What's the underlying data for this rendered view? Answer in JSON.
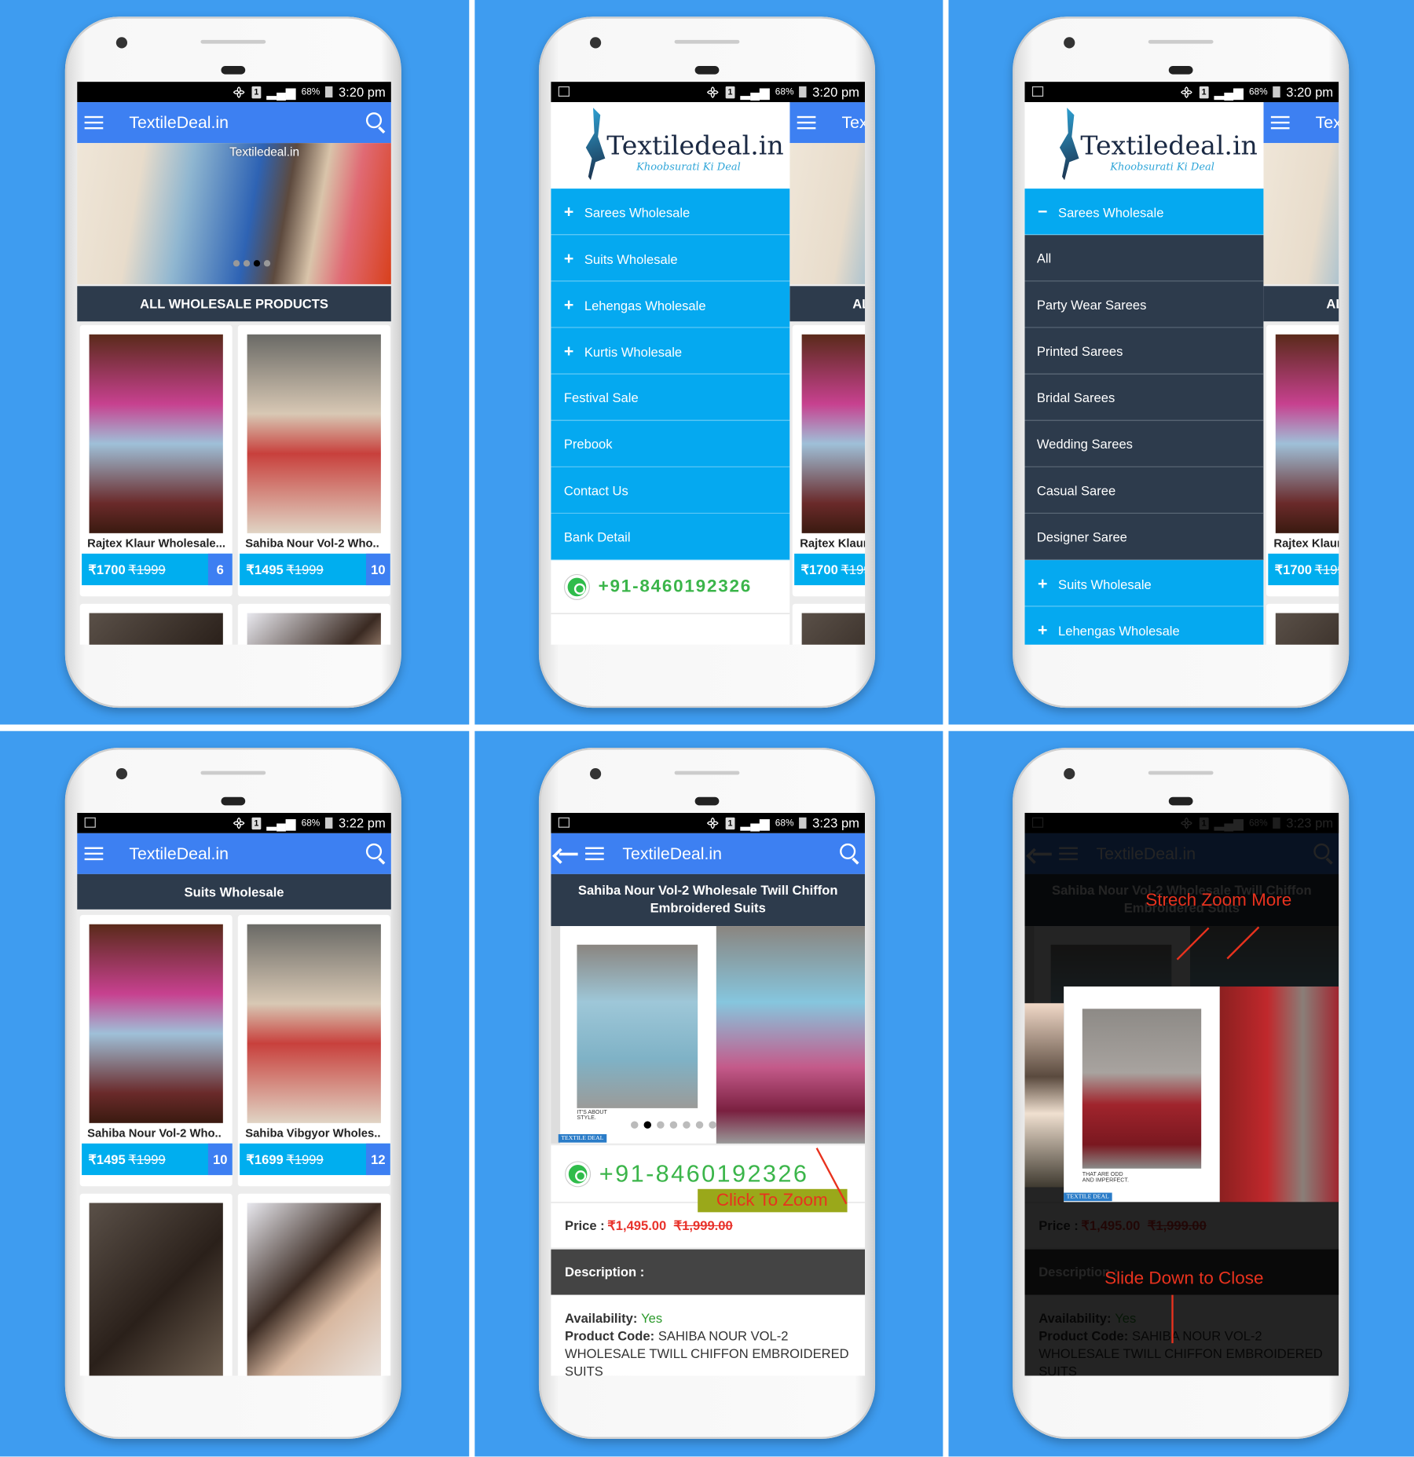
{
  "colors": {
    "background": "#3e9cf0",
    "appbar": "#3d80f2",
    "section_header": "#2d3b4c",
    "price_bar": "#00aeef",
    "count_badge": "#3d7ff2",
    "drawer_item": "#05a9f0",
    "whatsapp_green": "#3bb54a",
    "price_red": "#e8321e",
    "annotation": "#e8321e"
  },
  "status": {
    "battery": "68%",
    "sim": "1",
    "times": [
      "3:20 pm",
      "3:20 pm",
      "3:20 pm",
      "3:22 pm",
      "3:23 pm",
      "3:23 pm"
    ]
  },
  "app_title": "TextileDeal.in",
  "banner": {
    "watermark": "Textiledeal.in",
    "slides": 4,
    "active_slide": 3
  },
  "home": {
    "section_title": "ALL WHOLESALE PRODUCTS",
    "products": [
      {
        "name": "Rajtex Klaur Wholesale...",
        "price": "₹1700",
        "mrp": "₹1999",
        "count": "6"
      },
      {
        "name": "Sahiba Nour Vol-2 Who..",
        "price": "₹1495",
        "mrp": "₹1999",
        "count": "10"
      }
    ]
  },
  "drawer": {
    "logo_text": "Textiledeal.in",
    "logo_tagline": "Khoobsurati Ki Deal",
    "phone": "+91-8460192326",
    "items": [
      {
        "label": "Sarees Wholesale",
        "icon": "plus"
      },
      {
        "label": "Suits Wholesale",
        "icon": "plus"
      },
      {
        "label": "Lehengas Wholesale",
        "icon": "plus"
      },
      {
        "label": "Kurtis Wholesale",
        "icon": "plus"
      },
      {
        "label": "Festival Sale",
        "icon": ""
      },
      {
        "label": "Prebook",
        "icon": ""
      },
      {
        "label": "Contact Us",
        "icon": ""
      },
      {
        "label": "Bank Detail",
        "icon": ""
      }
    ],
    "expanded": {
      "label": "Sarees Wholesale",
      "icon": "minus",
      "subitems": [
        "All",
        "Party Wear Sarees",
        "Printed Sarees",
        "Bridal Sarees",
        "Wedding Sarees",
        "Casual Saree",
        "Designer Saree"
      ],
      "after": [
        {
          "label": "Suits Wholesale",
          "icon": "plus"
        },
        {
          "label": "Lehengas Wholesale",
          "icon": "plus"
        }
      ]
    }
  },
  "suits": {
    "section_title": "Suits Wholesale",
    "products": [
      {
        "name": "Sahiba Nour Vol-2 Who..",
        "price": "₹1495",
        "mrp": "₹1999",
        "count": "10"
      },
      {
        "name": "Sahiba Vibgyor Wholes..",
        "price": "₹1699",
        "mrp": "₹1999",
        "count": "12"
      }
    ]
  },
  "detail": {
    "title": "Sahiba Nour Vol-2 Wholesale Twill Chiffon Embroidered Suits",
    "image_caption": "IT'S ABOUT STYLE.",
    "image_badge": "TEXTILE DEAL",
    "carousel": {
      "count": 7,
      "active": 2
    },
    "phone": "+91-8460192326",
    "price_label": "Price :",
    "price": "₹1,495.00",
    "mrp": "₹1,999.00",
    "description_label": "Description :",
    "availability_label": "Availability:",
    "availability": "Yes",
    "product_code_label": "Product Code:",
    "product_code": "SAHIBA NOUR VOL-2 WHOLESALE TWILL CHIFFON EMBROIDERED SUITS"
  },
  "zoom": {
    "image_caption": "THAT ARE ODD AND IMPERFECT.",
    "image_badge": "TEXTILE DEAL"
  },
  "annotations": {
    "click_to_zoom": "Click To Zoom",
    "stretch_zoom": "Strech Zoom More",
    "slide_close": "Slide Down to Close"
  }
}
